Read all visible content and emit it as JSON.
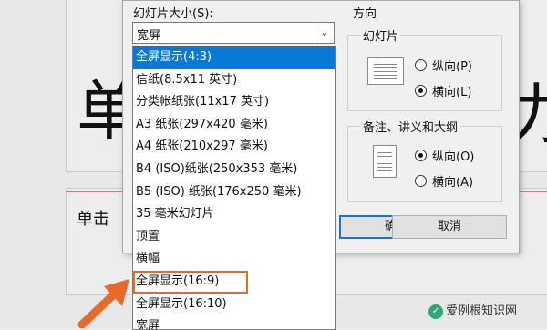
{
  "slide": {
    "title_left_char": "单",
    "title_right_char": "力",
    "subtitle_text": "单击"
  },
  "dialog": {
    "size_label": "幻灯片大小(S):",
    "orientation_label": "方向",
    "combo_value": "宽屏",
    "dropdown_items": [
      "全屏显示(4:3)",
      "信纸(8.5x11 英寸)",
      "分类帐纸张(11x17 英寸)",
      "A3 纸张(297x420 毫米)",
      "A4 纸张(210x297 毫米)",
      "B4 (ISO)纸张(250x353 毫米)",
      "B5 (ISO) 纸张(176x250 毫米)",
      "35 毫米幻灯片",
      "顶置",
      "横幅",
      "全屏显示(16:9)",
      "全屏显示(16:10)",
      "宽屏"
    ],
    "slides_group": {
      "label": "幻灯片",
      "portrait": "纵向(P)",
      "landscape": "横向(L)",
      "selected": "landscape"
    },
    "notes_group": {
      "label": "备注、讲义和大纲",
      "portrait": "纵向(O)",
      "landscape": "横向(A)",
      "selected": "portrait"
    },
    "ok_label": "确定",
    "cancel_label": "取消"
  },
  "watermark": {
    "text": "爱例根知识网"
  },
  "colors": {
    "selection": "#0a78d7",
    "highlight_box": "#e8692a",
    "arrow": "#e8692a"
  }
}
